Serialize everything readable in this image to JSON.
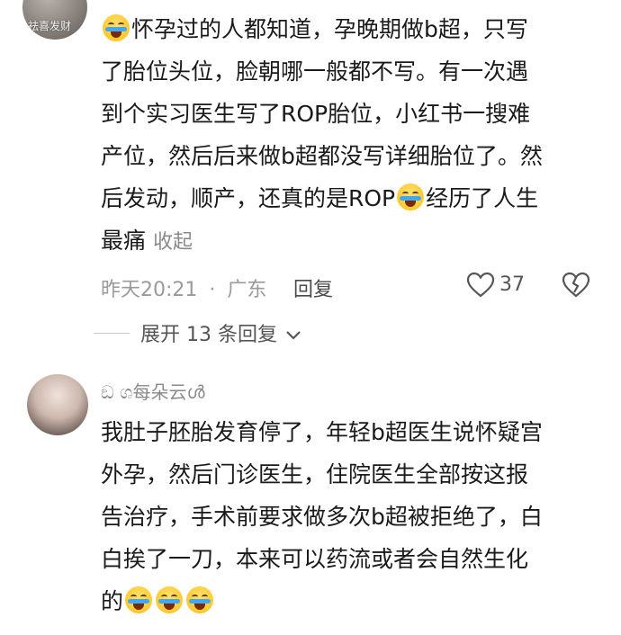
{
  "comment1": {
    "avatar_watermark": "祛喜发财",
    "lines": [
      "怀孕过的人都知道，孕晚期做b超，只写",
      "了胎位头位，脸朝哪一般都不写。有一次遇",
      "到个实习医生写了ROP胎位，小红书一搜难",
      "产位，然后后来做b超都没写详细胎位了。然",
      "后发动，顺产，还真的是ROP",
      "经历了人生",
      "最痛"
    ],
    "collapse_label": "收起",
    "time": "昨天20:21",
    "location": "广东",
    "separator": "·",
    "reply_label": "回复",
    "like_count": "37",
    "expand_label": "展开 13 条回复"
  },
  "comment2": {
    "username": "ඞ ශ每朵云ൾ",
    "lines": [
      "我肚子胚胎发育停了，年轻b超医生说怀疑宫",
      "外孕，然后门诊医生，住院医生全部按这报",
      "告治疗，手术前要求做多次b超被拒绝了，白",
      "白挨了一刀，本来可以药流或者会自然生化",
      "的"
    ]
  },
  "icons": {
    "like": "heart-outline-icon",
    "dislike": "broken-heart-icon",
    "chevron": "chevron-down-icon",
    "emoji_cry": "crying-face-emoji",
    "emoji_laugh_cry": "laughing-crying-emoji"
  },
  "colors": {
    "text": "#1a1a1a",
    "meta": "#9a9a9a",
    "action": "#555555"
  }
}
